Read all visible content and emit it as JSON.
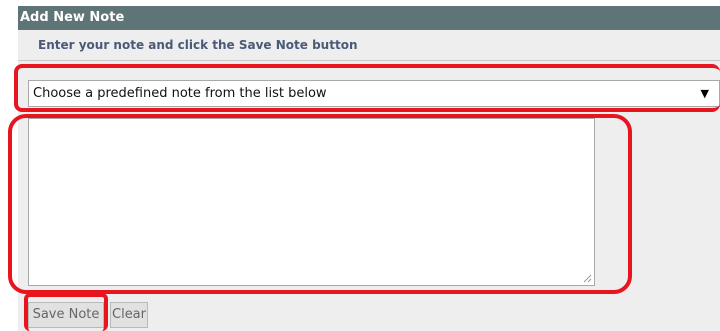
{
  "form": {
    "title": "Add New Note",
    "instruction": "Enter your note and click the Save Note button",
    "select": {
      "selected": "Choose a predefined note from the list below"
    },
    "note_text": "",
    "buttons": {
      "save_label": "Save Note",
      "clear_label": "Clear"
    }
  },
  "colors": {
    "header_bg": "#5f7476",
    "highlight": "#e8141e",
    "instruction_text": "#4b5a78"
  },
  "icons": {
    "select_arrow": "dropdown-arrow-icon",
    "resize": "resize-grip-icon"
  }
}
